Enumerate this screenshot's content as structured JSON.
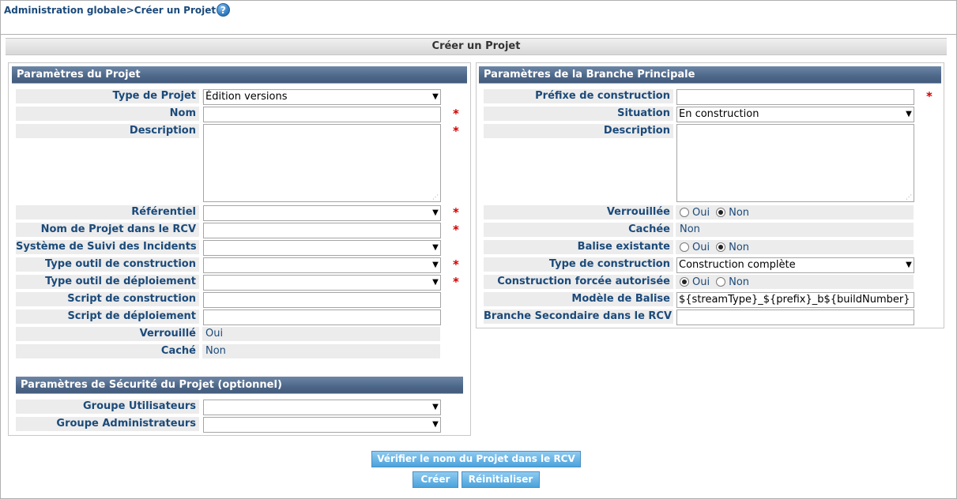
{
  "breadcrumb": "Administration globale>Créer un Projet",
  "help_icon_symbol": "?",
  "main_title": "Créer un Projet",
  "project_section": {
    "title": "Paramètres du Projet",
    "type_label": "Type de Projet",
    "type_value": "Édition versions",
    "name_label": "Nom",
    "name_value": "",
    "description_label": "Description",
    "repository_label": "Référentiel",
    "repository_value": "",
    "rcv_name_label": "Nom de Projet dans le RCV",
    "rcv_name_value": "",
    "issue_tracker_label": "Système de Suivi des Incidents",
    "issue_tracker_value": "",
    "build_tool_label": "Type outil de construction",
    "build_tool_value": "",
    "deploy_tool_label": "Type outil de déploiement",
    "deploy_tool_value": "",
    "build_script_label": "Script de construction",
    "build_script_value": "",
    "deploy_script_label": "Script de déploiement",
    "deploy_script_value": "",
    "locked_label": "Verrouillé",
    "locked_value": "Oui",
    "hidden_label": "Caché",
    "hidden_value": "Non"
  },
  "security_section": {
    "title": "Paramètres de Sécurité du Projet (optionnel)",
    "user_group_label": "Groupe Utilisateurs",
    "user_group_value": "",
    "admin_group_label": "Groupe Administrateurs",
    "admin_group_value": ""
  },
  "branch_section": {
    "title": "Paramètres de la Branche Principale",
    "build_prefix_label": "Préfixe de construction",
    "build_prefix_value": "",
    "status_label": "Situation",
    "status_value": "En construction",
    "description_label": "Description",
    "locked_label": "Verrouillée",
    "hidden_label": "Cachée",
    "hidden_value": "Non",
    "existing_tag_label": "Balise existante",
    "build_type_label": "Type de construction",
    "build_type_value": "Construction complète",
    "forced_build_label": "Construction forcée autorisée",
    "tag_template_label": "Modèle de Balise",
    "tag_template_value": "${streamType}_${prefix}_b${buildNumber}",
    "secondary_branch_label": "Branche Secondaire dans le RCV",
    "secondary_branch_value": "",
    "yes": "Oui",
    "no": "Non"
  },
  "required_marker": "*",
  "select_arrow": "▼",
  "textarea_grip": "⋰",
  "buttons": {
    "verify": "Vérifier le nom du Projet dans le RCV",
    "create": "Créer",
    "reset": "Réinitialiser"
  }
}
